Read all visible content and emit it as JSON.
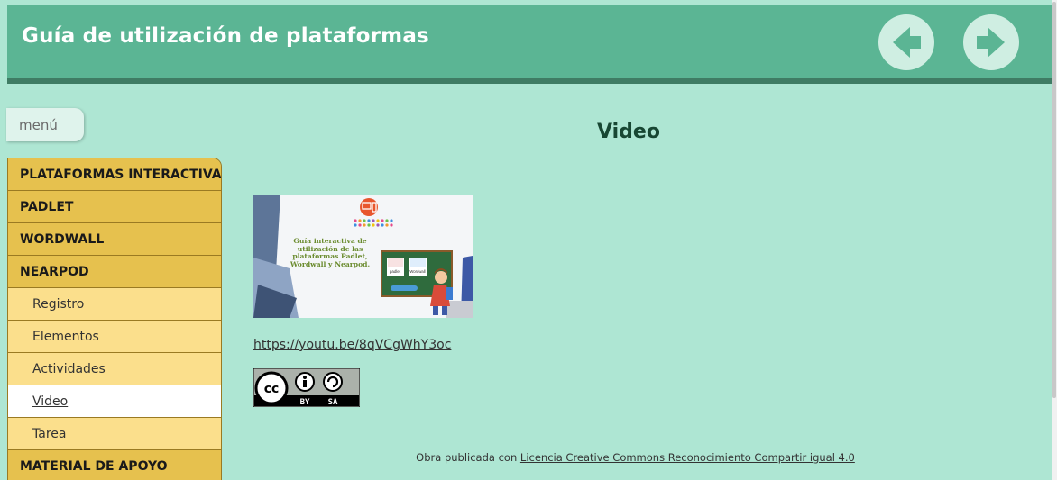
{
  "header": {
    "title": "Guía de utilización de plataformas",
    "prev_icon": "arrow-left-circle",
    "next_icon": "arrow-right-circle"
  },
  "menu": {
    "toggle_label": "menú"
  },
  "sidebar": {
    "items": [
      {
        "label": "PLATAFORMAS INTERACTIVAS",
        "level": "top"
      },
      {
        "label": "PADLET",
        "level": "top"
      },
      {
        "label": "WORDWALL",
        "level": "top"
      },
      {
        "label": "NEARPOD",
        "level": "top"
      },
      {
        "label": "Registro",
        "level": "sub"
      },
      {
        "label": "Elementos",
        "level": "sub"
      },
      {
        "label": "Actividades",
        "level": "sub"
      },
      {
        "label": "Video",
        "level": "sub",
        "active": true
      },
      {
        "label": "Tarea",
        "level": "sub"
      },
      {
        "label": "MATERIAL DE APOYO",
        "level": "top"
      }
    ]
  },
  "main": {
    "title": "Video",
    "thumbnail": {
      "text": "Guía interactiva de utilización de las plataformas Padlet, Wordwall y Nearpod.",
      "card_labels": [
        "padlet",
        "Wordwall"
      ]
    },
    "video_link": "https://youtu.be/8qVCgWhY3oc",
    "license_badge": {
      "top": "cc",
      "by": "BY",
      "sa": "SA"
    }
  },
  "footer": {
    "prefix": "Obra publicada con ",
    "license_link": "Licencia Creative Commons Reconocimiento Compartir igual 4.0"
  },
  "colors": {
    "header_bg": "#5bb594",
    "page_bg": "#aee6d3",
    "sidebar_top": "#e6c14e",
    "sidebar_sub": "#fbdf8c",
    "title_color": "#184733"
  }
}
